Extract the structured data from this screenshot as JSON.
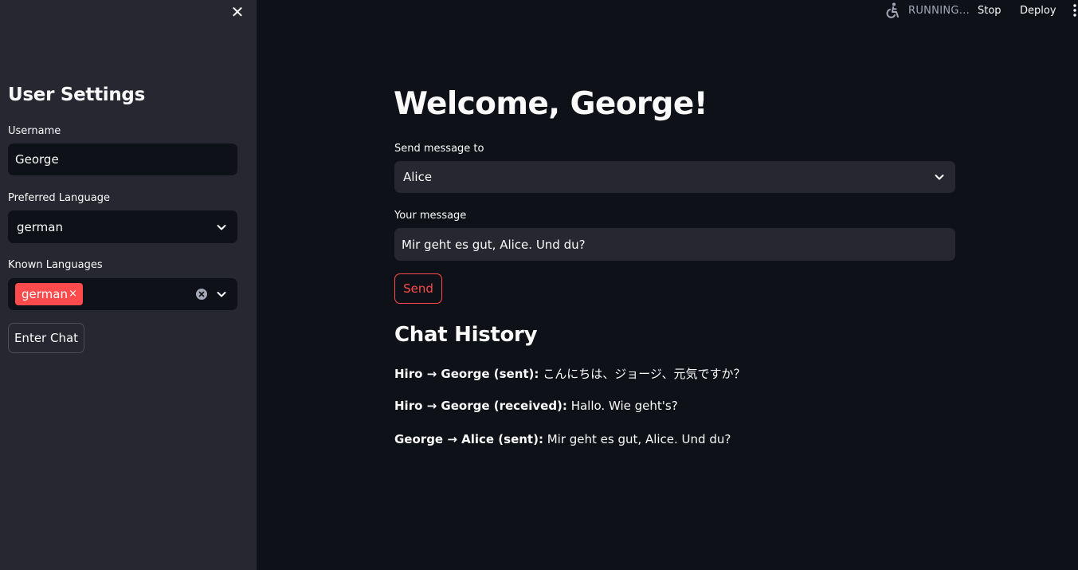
{
  "sidebar": {
    "close_glyph": "✕",
    "title": "User Settings",
    "username": {
      "label": "Username",
      "value": "George"
    },
    "preferred_language": {
      "label": "Preferred Language",
      "selected": "german"
    },
    "known_languages": {
      "label": "Known Languages",
      "chips": [
        "german"
      ],
      "chip_remove_glyph": "×"
    },
    "enter_button": "Enter Chat"
  },
  "header": {
    "status": "RUNNING...",
    "stop": "Stop",
    "deploy": "Deploy"
  },
  "main": {
    "title": "Welcome, George!",
    "recipient": {
      "label": "Send message to",
      "selected": "Alice"
    },
    "message": {
      "label": "Your message",
      "value": "Mir geht es gut, Alice. Und du?"
    },
    "send_button": "Send",
    "history_title": "Chat History",
    "history": [
      {
        "prefix": "Hiro → George (sent):",
        "text": "こんにちは、ジョージ、元気ですか？"
      },
      {
        "prefix": "Hiro → George (received):",
        "text": "Hallo. Wie geht's?"
      },
      {
        "prefix": "George → Alice (sent):",
        "text": "Mir geht es gut, Alice. Und du?"
      }
    ]
  },
  "colors": {
    "background": "#0e1117",
    "sidebar": "#262730",
    "accent": "#ff4b4b",
    "text": "#fafafa"
  },
  "icons": [
    "close-icon",
    "running-icon",
    "kebab-menu-icon",
    "chevron-down-icon",
    "clear-all-icon"
  ]
}
